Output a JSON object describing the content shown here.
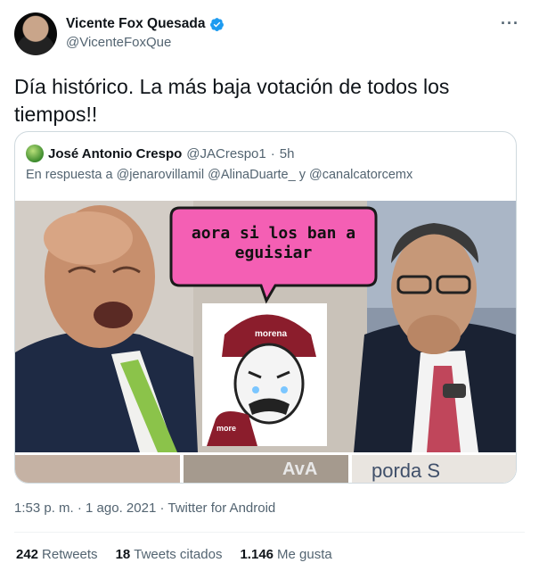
{
  "author": {
    "display_name": "Vicente Fox Quesada",
    "handle": "@VicenteFoxQue",
    "verified_icon": "verified-badge-icon",
    "more_glyph": "···"
  },
  "tweet": {
    "text": "Día histórico. La más baja votación de todos los tiempos!!"
  },
  "quoted": {
    "display_name": "José Antonio Crespo",
    "handle": "@JACrespo1",
    "separator": "·",
    "time": "5h",
    "reply_prefix": "En respuesta a",
    "reply_mentions": "@jenarovillamil @AlinaDuarte_ y @canalcatorcemx",
    "image": {
      "speech_bubble_text": "aora si los ban a eguisiar",
      "cap_text": "morena",
      "shirt_text": "more",
      "strip_watermark": "AvA",
      "strip_text": "porda S"
    }
  },
  "meta": {
    "time": "1:53 p. m.",
    "date": "1 ago. 2021",
    "source": "Twitter for Android",
    "sep": "·"
  },
  "stats": [
    {
      "count": "242",
      "label": "Retweets"
    },
    {
      "count": "18",
      "label": "Tweets citados"
    },
    {
      "count": "1.146",
      "label": "Me gusta"
    }
  ],
  "colors": {
    "verified_blue": "#1d9bf0",
    "secondary_text": "#536471",
    "bubble_pink": "#f45fb4",
    "cap_maroon": "#8b1d2c"
  }
}
